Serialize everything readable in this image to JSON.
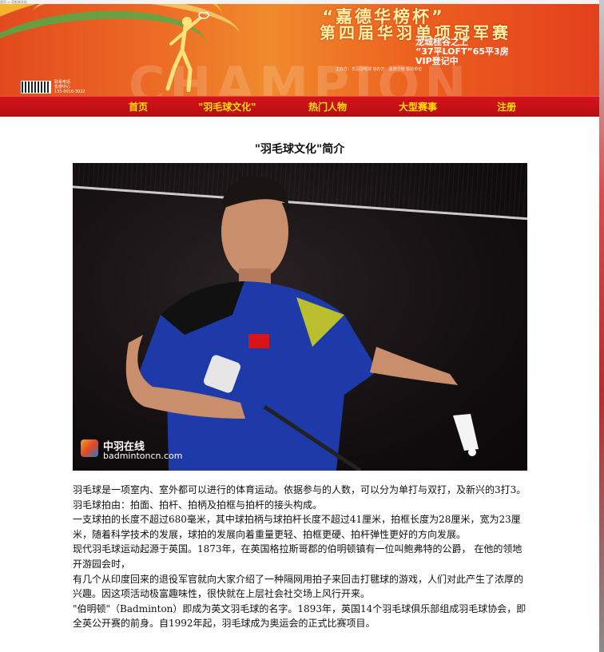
{
  "top_strip": {
    "text": "首页 > 羽毛球文化"
  },
  "banner": {
    "title_line1": "“嘉德华榜杯”",
    "title_line2": "第四届华羽单项冠军赛",
    "promo_line1": "龙城桂谷之上",
    "promo_line2": "“37平LOFT”65平3房",
    "promo_line3": "VIP登记中",
    "watermark_word": "CHAMPION",
    "contact_line1": "联系电话",
    "contact_line2": "售楼中心",
    "contact_line3": "135-0016-3922",
    "sponsors": "主办方：华羽羽毛球   协办方：嘉德华榜   赞助单位",
    "colors": {
      "primary": "#e24a1d",
      "accent": "#f7c72e",
      "text": "#fff2a0"
    }
  },
  "nav": {
    "items": [
      {
        "label": "首页"
      },
      {
        "label": "\"羽毛球文化\""
      },
      {
        "label": "热门人物"
      },
      {
        "label": "大型赛事"
      },
      {
        "label": "注册"
      }
    ],
    "colors": {
      "background": "#c8101a",
      "text": "#ffe000"
    }
  },
  "main": {
    "page_title": "\"羽毛球文化\"简介",
    "photo": {
      "watermark_cn": "中羽在线",
      "watermark_en": "badmintoncn.com"
    },
    "paragraphs": [
      "羽毛球是一项室内、室外都可以进行的体育运动。依据参与的人数，可以分为单打与双打，及新兴的3打3。",
      "羽毛球拍由：拍面、拍杆、拍柄及拍框与拍杆的接头构成。",
      "一支球拍的长度不超过680毫米，其中球拍柄与球拍杆长度不超过41厘米，拍框长度为28厘米，宽为23厘米，随着科学技术的发展，球拍的发展向着重量更轻、拍框更硬、拍杆弹性更好的方向发展。",
      "现代羽毛球运动起源于英国。1873年，在英国格拉斯哥郡的伯明顿镇有一位叫鲍弗特的公爵， 在他的领地开游园会时，",
      "有几个从印度回来的退役军官就向大家介绍了一种隔网用拍子来回击打毽球的游戏，人们对此产生了浓厚的兴趣。因这项活动极富趣味性，很快就在上层社会社交场上风行开来。",
      "\"伯明顿\"（Badminton）即成为英文羽毛球的名字。1893年，英国14个羽毛球俱乐部组成羽毛球协会，即全英公开赛的前身。自1992年起，羽毛球成为奥运会的正式比赛项目。"
    ]
  }
}
